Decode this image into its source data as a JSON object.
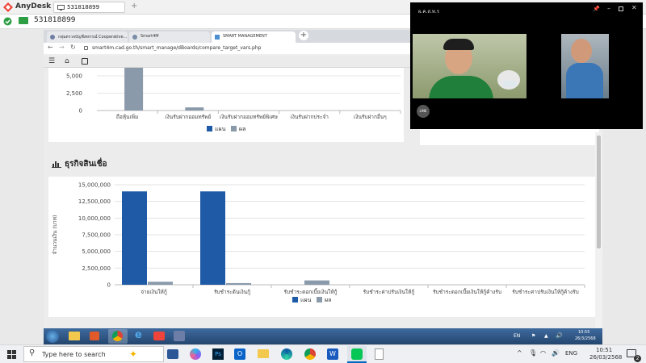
{
  "anydesk": {
    "app_name": "AnyDesk",
    "tab_id": "531818899",
    "address_id": "531818899"
  },
  "browser": {
    "tabs": [
      {
        "label": "กลุ่มตรวจบัญชีสหกรณ์ Cooperative..."
      },
      {
        "label": "Smart4M"
      },
      {
        "label": "SMART MANAGEMENT"
      }
    ],
    "url": "smart4m.cad.go.th/smart_manage/dBoards/compare_target_vars.php"
  },
  "top_chart": {
    "y_ticks": [
      "5,000",
      "2,500",
      "0"
    ],
    "categories": [
      "ถือหุ้นเพิ่ม",
      "เงินรับฝากออมทรัพย์",
      "เงินรับฝากออมทรัพย์พิเศษ",
      "เงินรับฝากประจำ",
      "เงินรับฝากอื่นๆ"
    ],
    "legend": [
      "แผน",
      "ผล"
    ]
  },
  "section": {
    "title": "ธุรกิจสินเชื่อ"
  },
  "chart_data": [
    {
      "type": "bar",
      "categories": [
        "ถือหุ้นเพิ่ม",
        "เงินรับฝากออมทรัพย์",
        "เงินรับฝากออมทรัพย์พิเศษ",
        "เงินรับฝากประจำ",
        "เงินรับฝากอื่นๆ"
      ],
      "series": [
        {
          "name": "แผน",
          "values": [
            0,
            0,
            0,
            0,
            0
          ]
        },
        {
          "name": "ผล",
          "values": [
            6500,
            450,
            0,
            0,
            0
          ]
        }
      ],
      "ylim": [
        0,
        5000
      ],
      "colors": [
        "#1f5aa6",
        "#8a9aab"
      ]
    },
    {
      "type": "bar",
      "ylabel": "จำนวนเงิน (บาท)",
      "categories": [
        "จ่ายเงินให้กู้",
        "รับชำระต้นเงินกู้",
        "รับชำระดอกเบี้ยเงินให้กู้",
        "รับชำระค่าปรับเงินให้กู้",
        "รับชำระดอกเบี้ยเงินให้กู้ค้างรับ",
        "รับชำระค่าปรับเงินให้กู้ค้างรับ"
      ],
      "series": [
        {
          "name": "แผน",
          "values": [
            14000000,
            14000000,
            0,
            0,
            0,
            0
          ]
        },
        {
          "name": "ผล",
          "values": [
            450000,
            250000,
            650000,
            0,
            0,
            0
          ]
        }
      ],
      "ylim": [
        0,
        15000000
      ],
      "y_ticks": [
        "15,000,000",
        "12,500,000",
        "10,000,000",
        "7,500,000",
        "5,000,000",
        "2,500,000",
        "0"
      ],
      "legend": [
        "แผน",
        "ผล"
      ],
      "colors": [
        "#1f5aa6",
        "#8a9aab"
      ]
    }
  ],
  "video_call": {
    "title": "ผ.ค.ส.ท.ร"
  },
  "win7_taskbar": {
    "lang": "EN",
    "time": "10:55",
    "date": "26/3/2568"
  },
  "windows_taskbar": {
    "search_placeholder": "Type here to search",
    "lang": "ENG",
    "time": "10:51",
    "date": "26/03/2568",
    "notification_count": "2"
  },
  "colors": {
    "plan": "#1f5aa6",
    "actual": "#8a9aab",
    "anydesk_red": "#ef443b"
  }
}
